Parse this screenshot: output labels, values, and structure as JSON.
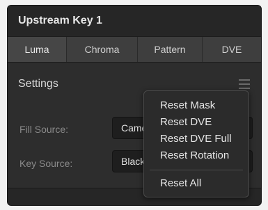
{
  "panel": {
    "title": "Upstream Key 1"
  },
  "tabs": [
    {
      "label": "Luma",
      "active": true
    },
    {
      "label": "Chroma",
      "active": false
    },
    {
      "label": "Pattern",
      "active": false
    },
    {
      "label": "DVE",
      "active": false
    }
  ],
  "settings": {
    "heading": "Settings",
    "fill_source": {
      "label": "Fill Source:",
      "value": "Came"
    },
    "key_source": {
      "label": "Key Source:",
      "value": "Black"
    }
  },
  "context_menu": {
    "items": [
      "Reset Mask",
      "Reset DVE",
      "Reset DVE Full",
      "Reset Rotation"
    ],
    "reset_all": "Reset All"
  },
  "icons": {
    "settings_menu": "hamburger-menu-icon"
  }
}
